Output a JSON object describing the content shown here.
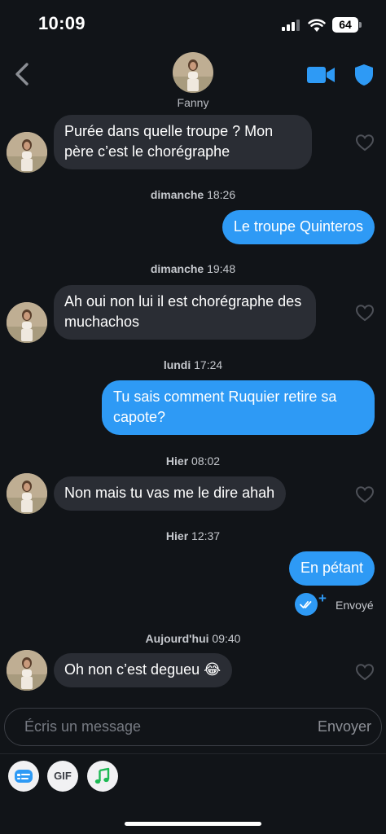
{
  "status_bar": {
    "time": "10:09",
    "battery": "64"
  },
  "header": {
    "contact_name": "Fanny"
  },
  "messages": [
    {
      "side": "in",
      "text": "Purée dans quelle troupe ? Mon père c’est le chorégraphe"
    },
    {
      "timestamp_day": "dimanche",
      "timestamp_time": "18:26"
    },
    {
      "side": "out",
      "text": "Le troupe Quinteros"
    },
    {
      "timestamp_day": "dimanche",
      "timestamp_time": "19:48"
    },
    {
      "side": "in",
      "text": "Ah oui non lui il est chorégraphe des muchachos"
    },
    {
      "timestamp_day": "lundi",
      "timestamp_time": "17:24"
    },
    {
      "side": "out",
      "text": "Tu sais comment Ruquier retire sa capote?"
    },
    {
      "timestamp_day": "Hier",
      "timestamp_time": "08:02"
    },
    {
      "side": "in",
      "text": "Non mais tu vas me le dire ahah"
    },
    {
      "timestamp_day": "Hier",
      "timestamp_time": "12:37"
    },
    {
      "side": "out",
      "text": "En pétant",
      "status": "Envoyé"
    },
    {
      "timestamp_day": "Aujourd'hui",
      "timestamp_time": "09:40"
    },
    {
      "side": "in",
      "text": "Oh non c’est degueu 😂"
    }
  ],
  "composer": {
    "placeholder": "Écris un message",
    "send_label": "Envoyer"
  },
  "toolbar": {
    "gif_label": "GIF"
  },
  "icons": {
    "back": "chevron-left-icon",
    "video": "video-camera-icon",
    "shield": "shield-icon",
    "heart": "heart-outline-icon",
    "sticker": "sticker-icon",
    "music": "music-note-icon"
  },
  "colors": {
    "accent": "#2e9af5",
    "background": "#111418",
    "incoming_bubble": "#2a2d34",
    "music_green": "#1db954"
  }
}
